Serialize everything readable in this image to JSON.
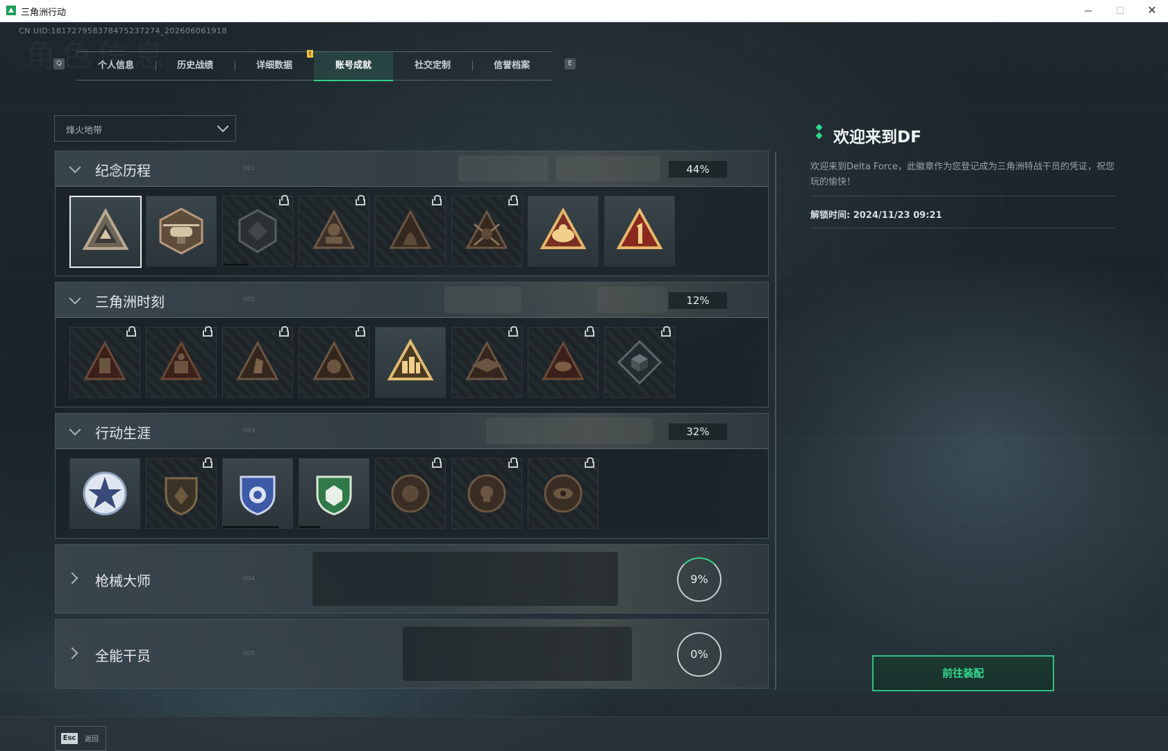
{
  "window": {
    "title": "三角洲行动",
    "min": "─",
    "max": "☐",
    "close": "✕"
  },
  "uid": "CN UID:181727958378475237274_202606061918",
  "ghost_title": "角色信息",
  "tabs": {
    "left_key": "Q",
    "right_key": "E",
    "notif": "!",
    "items": [
      "个人信息",
      "历史战绩",
      "详细数据",
      "账号成就",
      "社交定制",
      "信誉档案"
    ],
    "active": "账号成就"
  },
  "filter": {
    "selected": "烽火地带"
  },
  "sections": [
    {
      "title": "纪念历程",
      "num": "001",
      "percent": "44%",
      "expanded": true
    },
    {
      "title": "三角洲时刻",
      "num": "002",
      "percent": "12%",
      "expanded": true
    },
    {
      "title": "行动生涯",
      "num": "003",
      "percent": "32%",
      "expanded": true
    },
    {
      "title": "枪械大师",
      "num": "004",
      "percent": "9%",
      "expanded": false,
      "progress": 0.09
    },
    {
      "title": "全能干员",
      "num": "005",
      "percent": "0%",
      "expanded": false,
      "progress": 0.0
    }
  ],
  "badges": {
    "row1": [
      {
        "icon": "triangle-emblem-icon",
        "locked": false,
        "selected": true
      },
      {
        "icon": "helicopter-badge-icon",
        "locked": false
      },
      {
        "icon": "shield-badge-icon",
        "locked": true,
        "progress": 0.35
      },
      {
        "icon": "soldier-emblem-icon",
        "locked": true
      },
      {
        "icon": "hooded-figure-icon",
        "locked": true
      },
      {
        "icon": "crossed-swords-icon",
        "locked": true
      },
      {
        "icon": "gold-triangle-icon",
        "locked": false
      },
      {
        "icon": "number-one-triangle-icon",
        "locked": false
      }
    ],
    "row2": [
      {
        "icon": "backpack-triangle-icon",
        "locked": true
      },
      {
        "icon": "crate-triangle-icon",
        "locked": true
      },
      {
        "icon": "kneeling-soldier-icon",
        "locked": true
      },
      {
        "icon": "medic-triangle-icon",
        "locked": true
      },
      {
        "icon": "squad-triangle-icon",
        "locked": false
      },
      {
        "icon": "winged-triangle-icon",
        "locked": true
      },
      {
        "icon": "fish-triangle-icon",
        "locked": true
      },
      {
        "icon": "cube-diamond-icon",
        "locked": true
      }
    ],
    "row3": [
      {
        "icon": "star-medal-icon",
        "locked": false
      },
      {
        "icon": "bronze-shield-icon",
        "locked": true
      },
      {
        "icon": "blue-shield-icon",
        "locked": false,
        "progress": 0.8
      },
      {
        "icon": "green-shield-icon",
        "locked": false,
        "progress": 0.3
      },
      {
        "icon": "round-medal-icon",
        "locked": true
      },
      {
        "icon": "skull-medal-icon",
        "locked": true
      },
      {
        "icon": "eye-medal-icon",
        "locked": true
      }
    ]
  },
  "detail": {
    "title": "欢迎来到DF",
    "description": "欢迎来到Delta Force，此徽章作为您登记成为三角洲特战干员的凭证，祝您玩的愉快！",
    "unlock": "解锁时间: 2024/11/23 09:21",
    "button": "前往装配"
  },
  "footer": {
    "key": "Esc",
    "label": "返回"
  },
  "colors": {
    "accent": "#35d08c",
    "text": "#e4e9eb"
  }
}
